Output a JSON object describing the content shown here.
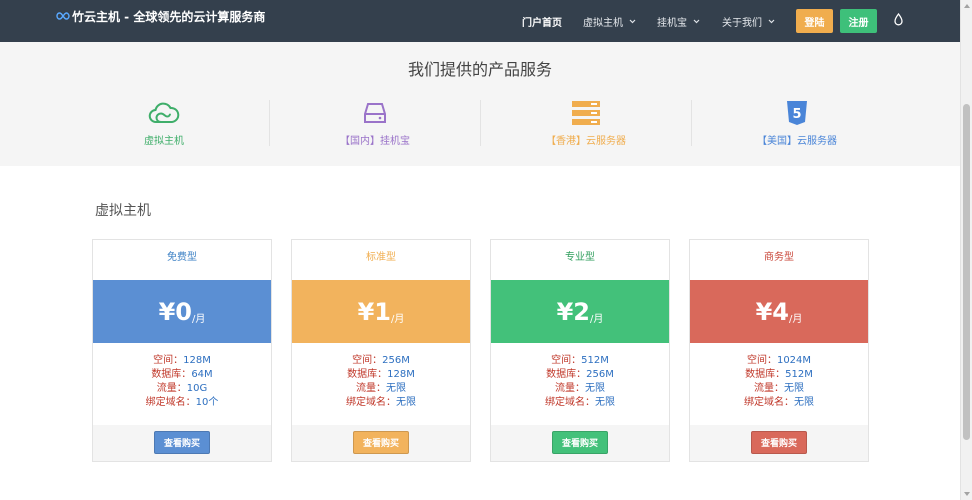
{
  "navbar": {
    "brand": "竹云主机 - 全球领先的云计算服务商",
    "items": [
      {
        "label": "门户首页",
        "active": true
      },
      {
        "label": "虚拟主机",
        "dropdown": true
      },
      {
        "label": "挂机宝",
        "dropdown": true
      },
      {
        "label": "关于我们",
        "dropdown": true
      }
    ],
    "login_label": "登陆",
    "register_label": "注册",
    "colors": {
      "bg": "#34404d",
      "login": "#f0ad4e",
      "register": "#3ec07a"
    }
  },
  "services": {
    "title": "我们提供的产品服务",
    "items": [
      {
        "label": "虚拟主机",
        "icon": "cloud-icon",
        "color": "#3fae6a"
      },
      {
        "label": "【国内】挂机宝",
        "icon": "hard-drive-icon",
        "color": "#9a73c9"
      },
      {
        "label": "【香港】云服务器",
        "icon": "server-stack-icon",
        "color": "#f0ad4e"
      },
      {
        "label": "【美国】云服务器",
        "icon": "html5-shield-icon",
        "color": "#4a85d8"
      }
    ]
  },
  "section": {
    "title": "虚拟主机"
  },
  "plans": [
    {
      "name": "免费型",
      "price": "¥0",
      "unit": "/月",
      "name_color": "#3a7fc4",
      "color": "#5b8fd3",
      "specs": [
        "空间：128M",
        "数据库：64M",
        "流量：10G",
        "绑定域名：10个"
      ],
      "btn": "查看购买"
    },
    {
      "name": "标准型",
      "price": "¥1",
      "unit": "/月",
      "name_color": "#f0ad4e",
      "color": "#f2b35d",
      "specs": [
        "空间：256M",
        "数据库：128M",
        "流量：无限",
        "绑定域名：无限"
      ],
      "btn": "查看购买"
    },
    {
      "name": "专业型",
      "price": "¥2",
      "unit": "/月",
      "name_color": "#2f9e5c",
      "color": "#43c17a",
      "specs": [
        "空间：512M",
        "数据库：256M",
        "流量：无限",
        "绑定域名：无限"
      ],
      "btn": "查看购买"
    },
    {
      "name": "商务型",
      "price": "¥4",
      "unit": "/月",
      "name_color": "#c9473a",
      "color": "#d9695b",
      "specs": [
        "空间：1024M",
        "数据库：512M",
        "流量：无限",
        "绑定域名：无限"
      ],
      "btn": "查看购买"
    }
  ],
  "spec_colors": {
    "label": "#c0392b",
    "value": "#2d6fc0"
  }
}
